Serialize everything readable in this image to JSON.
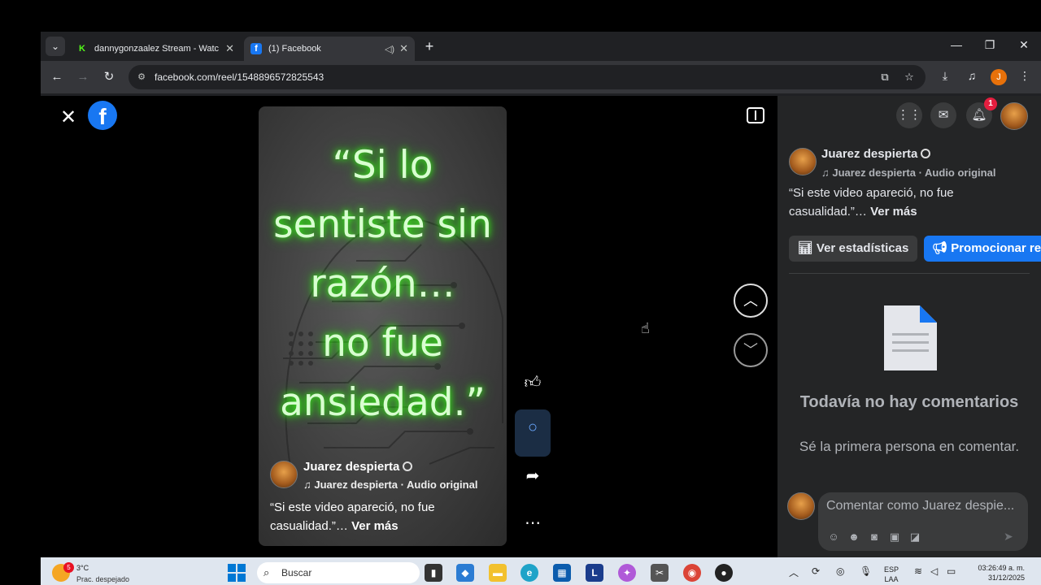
{
  "browser": {
    "tabs": [
      {
        "title": "dannygonzaalez Stream - Watc",
        "favicon": "kick-icon",
        "active": false
      },
      {
        "title": "(1) Facebook",
        "favicon": "facebook-icon",
        "active": true
      }
    ],
    "url": "facebook.com/reel/1548896572825543",
    "profile_initial": "J"
  },
  "reel": {
    "quote_text": "“Si lo\nsentiste sin\nrazón…\n no fue\nansiedad.”",
    "author": "Juarez despierta",
    "audio": "Juarez despierta · Audio original",
    "caption": "“Si este video apareció, no fue casualidad.”…",
    "see_more": "Ver más"
  },
  "panel": {
    "notification_count": "1",
    "author": "Juarez despierta",
    "audio": "Juarez despierta · Audio original",
    "caption": "“Si este video apareció, no fue casualidad.”…",
    "see_more": "Ver más",
    "stats_button": "Ver estadísticas",
    "promote_button": "Promocionar re",
    "empty_title": "Todavía no hay comentarios",
    "empty_subtitle": "Sé la primera persona en comentar.",
    "comment_placeholder": "Comentar como Juarez despie..."
  },
  "taskbar": {
    "weather_temp": "3°C",
    "weather_cond": "Prac. despejado",
    "weather_badge": "5",
    "search_text": "Buscar",
    "lang_line1": "ESP",
    "lang_line2": "LAA",
    "time": "03:26:49 a. m.",
    "date": "31/12/2025"
  },
  "colors": {
    "fb_blue": "#1877f2",
    "panel_bg": "#242526",
    "neon_green": "#39ff14"
  }
}
